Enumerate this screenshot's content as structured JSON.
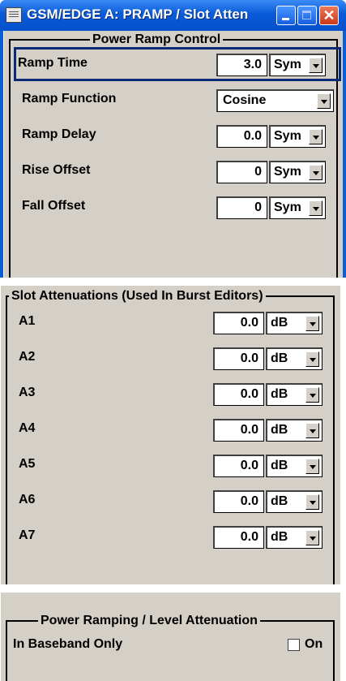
{
  "window": {
    "title": "GSM/EDGE A: PRAMP / Slot Atten"
  },
  "power_ramp_control": {
    "legend": "Power Ramp Control",
    "ramp_time": {
      "label": "Ramp Time",
      "value": "3.0",
      "unit": "Sym"
    },
    "ramp_function": {
      "label": "Ramp Function",
      "value": "Cosine"
    },
    "ramp_delay": {
      "label": "Ramp Delay",
      "value": "0.0",
      "unit": "Sym"
    },
    "rise_offset": {
      "label": "Rise Offset",
      "value": "0",
      "unit": "Sym"
    },
    "fall_offset": {
      "label": "Fall Offset",
      "value": "0",
      "unit": "Sym"
    }
  },
  "slot_attenuations": {
    "legend": "Slot Attenuations (Used In Burst Editors)",
    "items": [
      {
        "label": "A1",
        "value": "0.0",
        "unit": "dB"
      },
      {
        "label": "A2",
        "value": "0.0",
        "unit": "dB"
      },
      {
        "label": "A3",
        "value": "0.0",
        "unit": "dB"
      },
      {
        "label": "A4",
        "value": "0.0",
        "unit": "dB"
      },
      {
        "label": "A5",
        "value": "0.0",
        "unit": "dB"
      },
      {
        "label": "A6",
        "value": "0.0",
        "unit": "dB"
      },
      {
        "label": "A7",
        "value": "0.0",
        "unit": "dB"
      }
    ]
  },
  "level_attenuation": {
    "legend": "Power Ramping / Level Attenuation",
    "baseband_only": {
      "label": "In Baseband Only",
      "checkbox_label": "On",
      "checked": false
    }
  }
}
